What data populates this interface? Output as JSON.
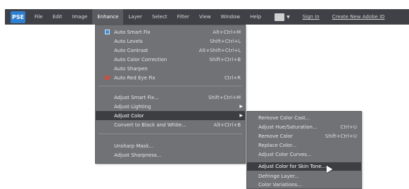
{
  "app": {
    "logo": "PSE"
  },
  "menubar": {
    "items": [
      "File",
      "Edit",
      "Image",
      "Enhance",
      "Layer",
      "Select",
      "Filter",
      "View",
      "Window",
      "Help"
    ],
    "links": [
      "Sign In",
      "Create New Adobe ID"
    ]
  },
  "enhance_menu": {
    "items": [
      {
        "label": "Auto Smart Fix",
        "shortcut": "Alt+Ctrl+M",
        "icon": "smart-fix-icon"
      },
      {
        "label": "Auto Levels",
        "shortcut": "Shift+Ctrl+L"
      },
      {
        "label": "Auto Contrast",
        "shortcut": "Alt+Shift+Ctrl+L"
      },
      {
        "label": "Auto Color Correction",
        "shortcut": "Shift+Ctrl+B"
      },
      {
        "label": "Auto Sharpen",
        "shortcut": ""
      },
      {
        "label": "Auto Red Eye Fix",
        "shortcut": "Ctrl+R",
        "icon": "red-eye-icon"
      },
      {
        "label": "Adjust Smart Fix...",
        "shortcut": "Shift+Ctrl+M"
      },
      {
        "label": "Adjust Lighting",
        "shortcut": ""
      },
      {
        "label": "Adjust Color",
        "shortcut": ""
      },
      {
        "label": "Convert to Black and White...",
        "shortcut": "Alt+Ctrl+B"
      },
      {
        "label": "Unsharp Mask...",
        "shortcut": ""
      },
      {
        "label": "Adjust Sharpness...",
        "shortcut": ""
      }
    ]
  },
  "adjust_color_submenu": {
    "items": [
      {
        "label": "Remove Color Cast...",
        "shortcut": ""
      },
      {
        "label": "Adjust Hue/Saturation...",
        "shortcut": "Ctrl+U"
      },
      {
        "label": "Remove Color",
        "shortcut": "Shift+Ctrl+U"
      },
      {
        "label": "Replace Color...",
        "shortcut": ""
      },
      {
        "label": "Adjust Color Curves...",
        "shortcut": ""
      },
      {
        "label": "Adjust Color for Skin Tone...",
        "shortcut": ""
      },
      {
        "label": "Defringe Layer...",
        "shortcut": ""
      },
      {
        "label": "Color Variations...",
        "shortcut": ""
      }
    ]
  }
}
